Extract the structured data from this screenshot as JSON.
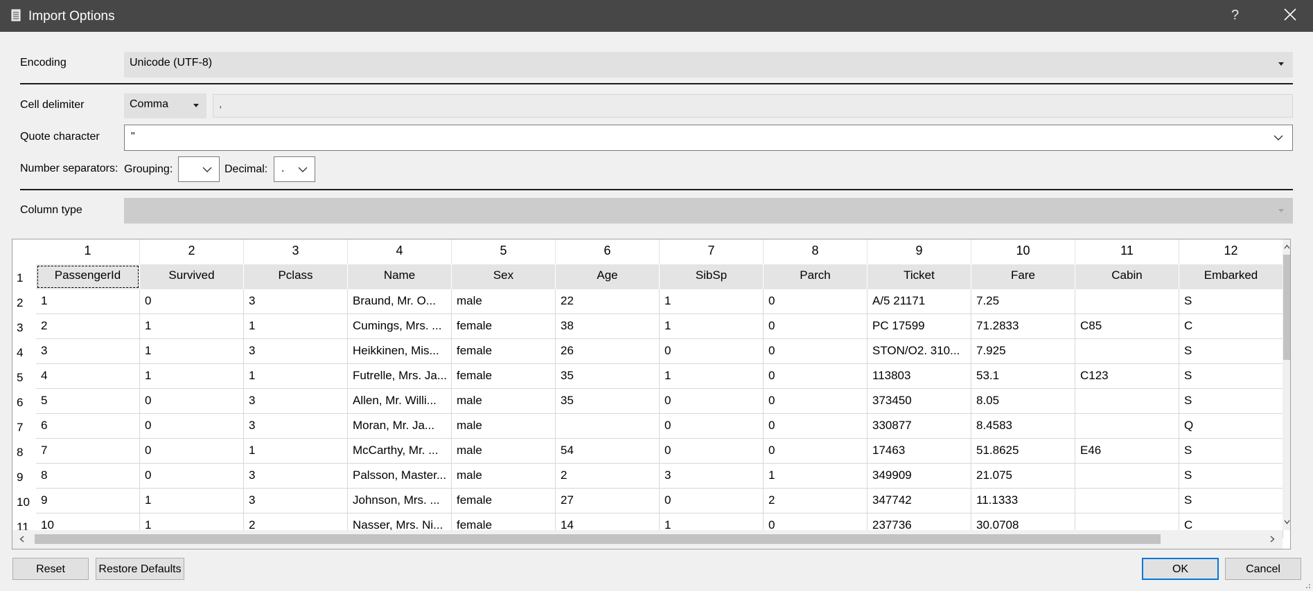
{
  "window": {
    "title": "Import Options",
    "help_glyph": "?",
    "close_icon": "close-icon",
    "app_icon": "document-icon"
  },
  "form": {
    "encoding_label": "Encoding",
    "encoding_value": "Unicode (UTF-8)",
    "cell_delimiter_label": "Cell delimiter",
    "cell_delimiter_value": "Comma",
    "cell_delimiter_text": ",",
    "quote_label": "Quote character",
    "quote_value": "\"",
    "number_separators_label": "Number separators:",
    "grouping_label": "Grouping:",
    "grouping_value": "",
    "decimal_label": "Decimal:",
    "decimal_value": ".",
    "column_type_label": "Column type",
    "column_type_value": ""
  },
  "table": {
    "column_numbers": [
      "1",
      "2",
      "3",
      "4",
      "5",
      "6",
      "7",
      "8",
      "9",
      "10",
      "11",
      "12"
    ],
    "headers": [
      "PassengerId",
      "Survived",
      "Pclass",
      "Name",
      "Sex",
      "Age",
      "SibSp",
      "Parch",
      "Ticket",
      "Fare",
      "Cabin",
      "Embarked"
    ],
    "row_numbers": [
      "1",
      "2",
      "3",
      "4",
      "5",
      "6",
      "7",
      "8",
      "9",
      "10",
      "11"
    ],
    "rows": [
      [
        "1",
        "0",
        "3",
        "Braund, Mr. O...",
        "male",
        "22",
        "1",
        "0",
        "A/5 21171",
        "7.25",
        "",
        "S"
      ],
      [
        "2",
        "1",
        "1",
        "Cumings, Mrs. ...",
        "female",
        "38",
        "1",
        "0",
        "PC 17599",
        "71.2833",
        "C85",
        "C"
      ],
      [
        "3",
        "1",
        "3",
        "Heikkinen, Mis...",
        "female",
        "26",
        "0",
        "0",
        "STON/O2. 310...",
        "7.925",
        "",
        "S"
      ],
      [
        "4",
        "1",
        "1",
        "Futrelle, Mrs. Ja...",
        "female",
        "35",
        "1",
        "0",
        "113803",
        "53.1",
        "C123",
        "S"
      ],
      [
        "5",
        "0",
        "3",
        "Allen, Mr. Willi...",
        "male",
        "35",
        "0",
        "0",
        "373450",
        "8.05",
        "",
        "S"
      ],
      [
        "6",
        "0",
        "3",
        "Moran, Mr. Ja...",
        "male",
        "",
        "0",
        "0",
        "330877",
        "8.4583",
        "",
        "Q"
      ],
      [
        "7",
        "0",
        "1",
        "McCarthy, Mr. ...",
        "male",
        "54",
        "0",
        "0",
        "17463",
        "51.8625",
        "E46",
        "S"
      ],
      [
        "8",
        "0",
        "3",
        "Palsson, Master...",
        "male",
        "2",
        "3",
        "1",
        "349909",
        "21.075",
        "",
        "S"
      ],
      [
        "9",
        "1",
        "3",
        "Johnson, Mrs. ...",
        "female",
        "27",
        "0",
        "2",
        "347742",
        "11.1333",
        "",
        "S"
      ],
      [
        "10",
        "1",
        "2",
        "Nasser, Mrs. Ni...",
        "female",
        "14",
        "1",
        "0",
        "237736",
        "30.0708",
        "",
        "C"
      ]
    ]
  },
  "buttons": {
    "reset": "Reset",
    "restore_defaults": "Restore Defaults",
    "ok": "OK",
    "cancel": "Cancel"
  }
}
